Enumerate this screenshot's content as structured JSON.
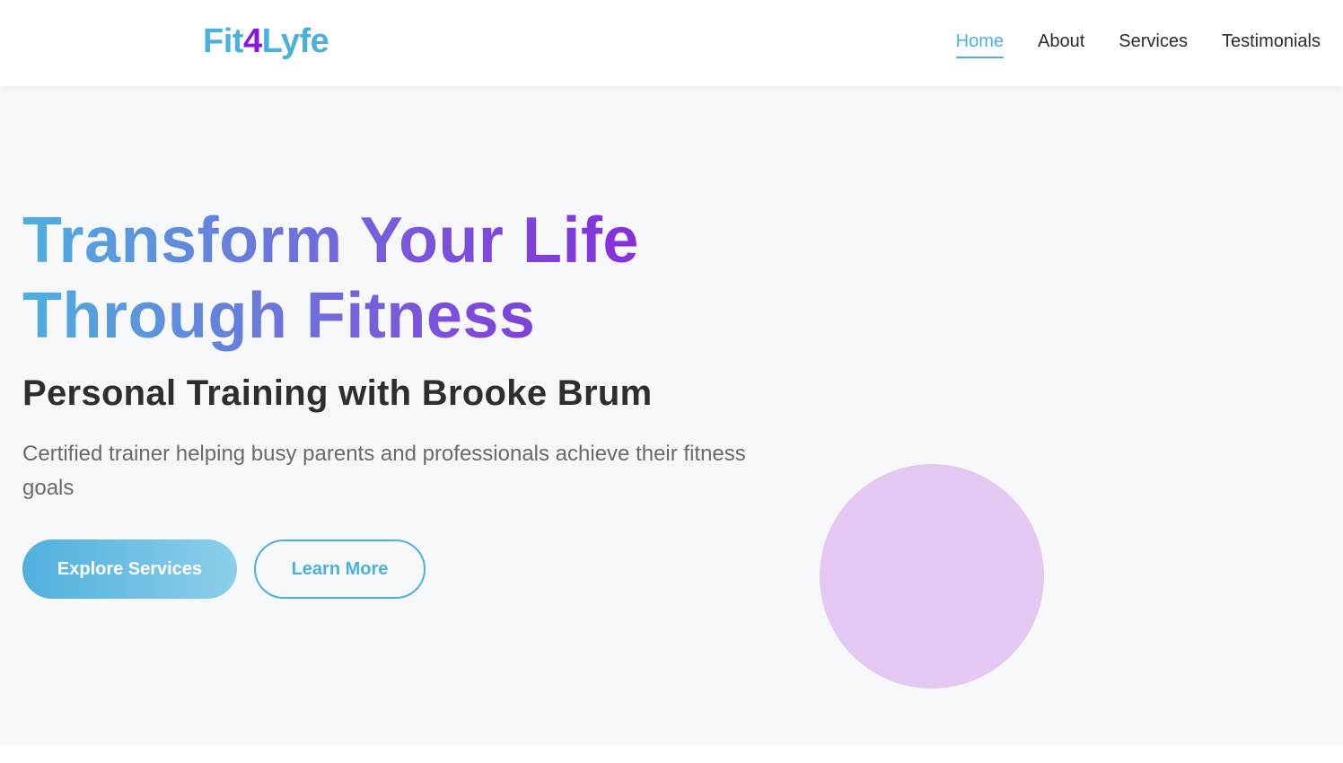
{
  "navbar": {
    "logo": {
      "part1": "Fit",
      "part2": "4",
      "part3": "Lyfe"
    },
    "links": [
      "Home",
      "About",
      "Services",
      "Testimonials"
    ],
    "active_link": "Home"
  },
  "hero": {
    "headline_line1": "Transform Your Life",
    "headline_line2": "Through Fitness",
    "subheadline": "Personal Training with Brooke Brum",
    "description": "Certified trainer helping busy parents and professionals achieve their fitness goals",
    "primary_button": "Explore Services",
    "secondary_button": "Learn More"
  },
  "colors": {
    "accent_blue": "#4bb1dc",
    "accent_purple": "#8a18d8",
    "circle": "#e4c8f2",
    "hero_background": "#f7f8fa"
  }
}
